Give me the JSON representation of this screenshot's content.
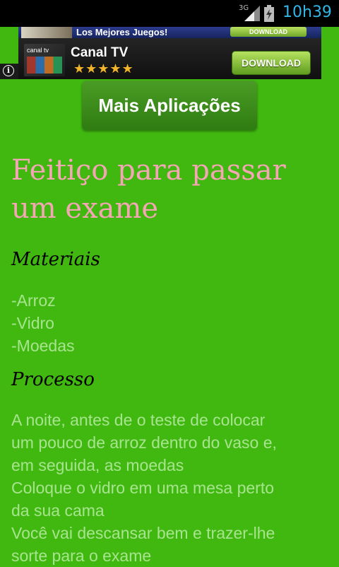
{
  "status_bar": {
    "network": "3G",
    "time": "10h39"
  },
  "ad": {
    "top_title": "Los Mejores Juegos!",
    "top_download": "DOWNLOAD",
    "thumb_brand": "canal tv",
    "name": "Canal TV",
    "stars": "★★★★★",
    "download": "DOWNLOAD",
    "info": "i"
  },
  "apps_button": "Mais Aplicações",
  "title": "Feitiço para passar um exame",
  "materials_heading": "Materiais",
  "materials": [
    "-Arroz",
    "-Vidro",
    "-Moedas"
  ],
  "process_heading": "Processo",
  "process_lines": [
    "A noite, antes de o teste de colocar",
    "um pouco de arroz dentro do vaso e,",
    "em seguida, as moedas",
    "Coloque o vidro em uma mesa perto",
    "da sua cama",
    "Você vai descansar bem e trazer-lhe",
    "sorte para o exame"
  ]
}
